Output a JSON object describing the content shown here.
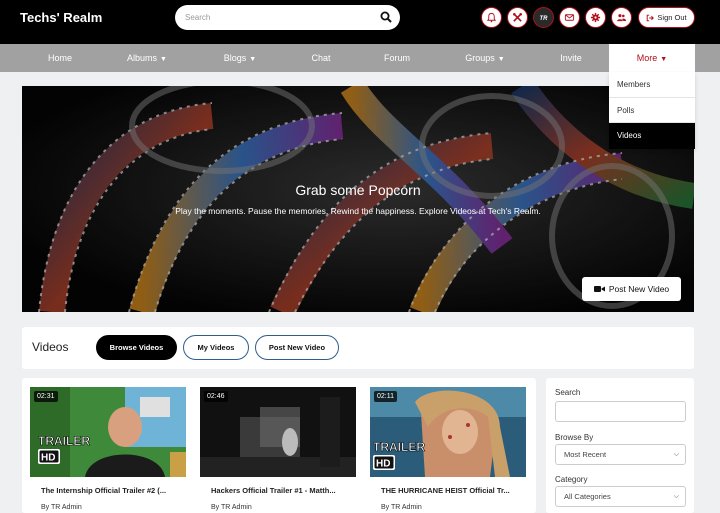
{
  "header": {
    "brand": "Techs' Realm",
    "search_placeholder": "Search",
    "sign_out": "Sign Out",
    "icons": [
      "bell-icon",
      "tools-icon",
      "tr-logo-icon",
      "mail-icon",
      "gear-icon",
      "users-icon"
    ]
  },
  "nav": {
    "items": [
      {
        "label": "Home",
        "has_chevron": false
      },
      {
        "label": "Albums",
        "has_chevron": true
      },
      {
        "label": "Blogs",
        "has_chevron": true
      },
      {
        "label": "Chat",
        "has_chevron": false
      },
      {
        "label": "Forum",
        "has_chevron": false
      },
      {
        "label": "Groups",
        "has_chevron": true
      },
      {
        "label": "Invite",
        "has_chevron": false
      },
      {
        "label": "More",
        "has_chevron": true,
        "active": true
      }
    ],
    "more_menu": [
      "Members",
      "Polls",
      "Videos"
    ],
    "more_menu_active": "Videos"
  },
  "hero": {
    "title": "Grab some Popcorn",
    "subtitle": "Play the moments. Pause the memories. Rewind the happiness. Explore Videos at Tech's Realm.",
    "button": "Post New Video"
  },
  "tabs": {
    "title": "Videos",
    "buttons": [
      "Browse Videos",
      "My Videos",
      "Post New Video"
    ],
    "active": "Browse Videos"
  },
  "videos": [
    {
      "duration": "02:31",
      "title": "The Internship Official Trailer #2 (...",
      "author": "By TR Admin",
      "badge": "TRAILER HD"
    },
    {
      "duration": "02:46",
      "title": "Hackers Official Trailer #1 - Matth...",
      "author": "By TR Admin",
      "badge": ""
    },
    {
      "duration": "02:11",
      "title": "THE HURRICANE HEIST Official Tr...",
      "author": "By TR Admin",
      "badge": "TRAILER HD"
    }
  ],
  "filters": {
    "search_label": "Search",
    "search_value": "",
    "browse_label": "Browse By",
    "browse_value": "Most Recent",
    "category_label": "Category",
    "category_value": "All Categories"
  },
  "colors": {
    "accent": "#b0101a",
    "nav_bg": "#a1a1a1",
    "topbar_bg": "#000000",
    "page_bg": "#eef0f2"
  }
}
